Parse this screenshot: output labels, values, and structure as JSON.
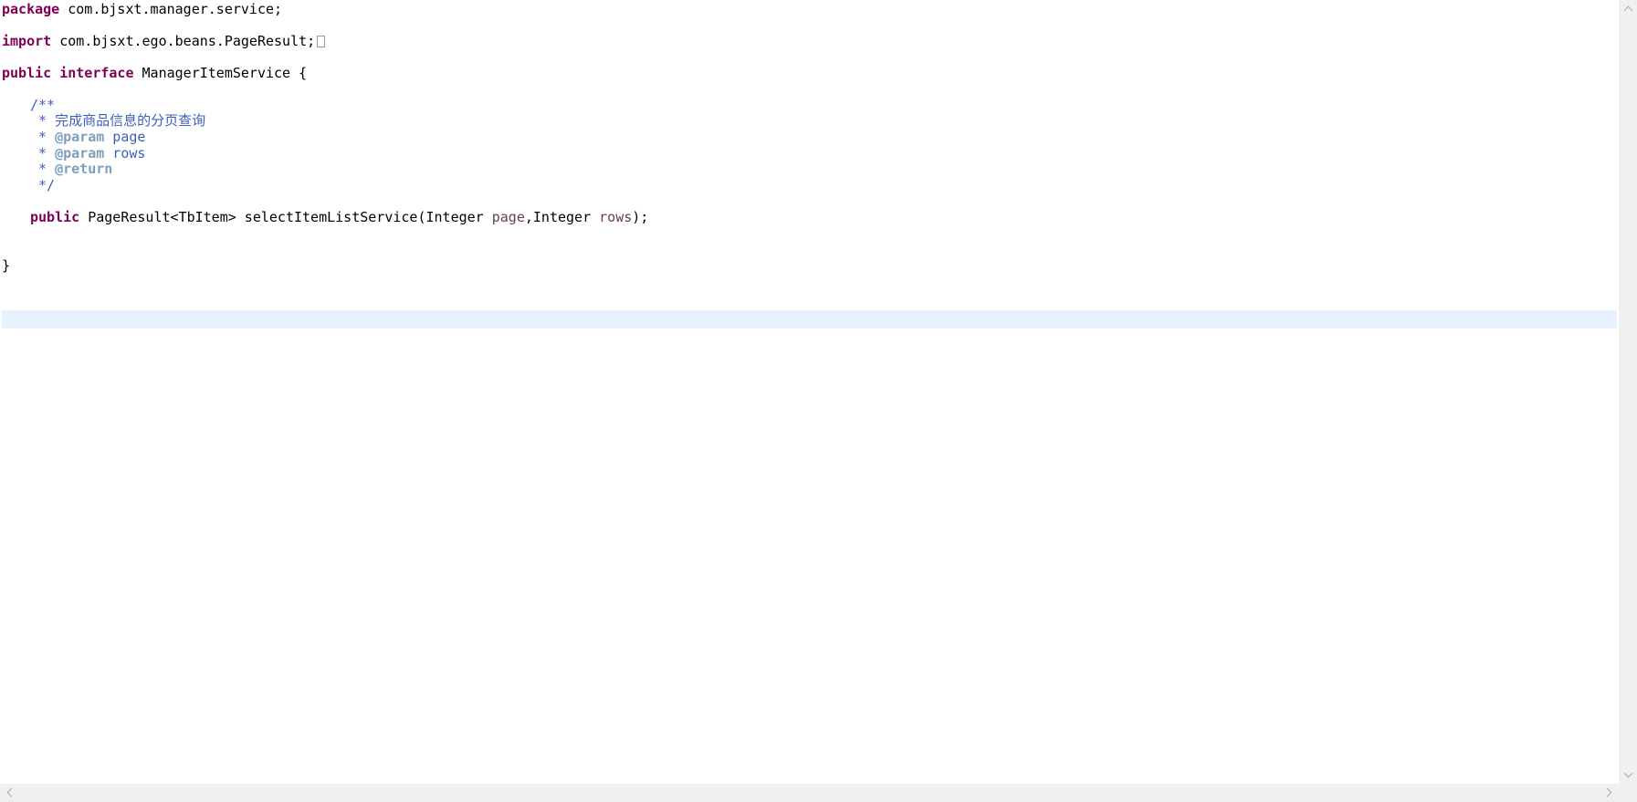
{
  "editor": {
    "lines": [
      {
        "kw": "package",
        "rest": " com.bjsxt.manager.service;"
      },
      {
        "kw": "import",
        "rest": " com.bjsxt.ego.beans.PageResult;"
      },
      {
        "kw1": "public",
        "kw2": "interface",
        "rest": " ManagerItemService {"
      },
      {
        "doc": "/**"
      },
      {
        "doc": " * 完成商品信息的分页查询"
      },
      {
        "doc_prefix": " * ",
        "tag": "@param",
        "doc_rest": " page"
      },
      {
        "doc_prefix": " * ",
        "tag": "@param",
        "doc_rest": " rows"
      },
      {
        "doc_prefix": " * ",
        "tag": "@return"
      },
      {
        "doc": " */"
      },
      {
        "kw": "public",
        "type": " PageResult<TbItem> selectItemListService(Integer ",
        "p1": "page",
        "mid": ",Integer ",
        "p2": "rows",
        "end": ");"
      },
      {
        "text": "}"
      }
    ]
  },
  "colors": {
    "keyword": "#7f0055",
    "javadoc": "#3f5fbf",
    "javadoc_tag": "#7f9fbf",
    "parameter": "#6a3e3e",
    "current_line": "#e8f2fe"
  }
}
